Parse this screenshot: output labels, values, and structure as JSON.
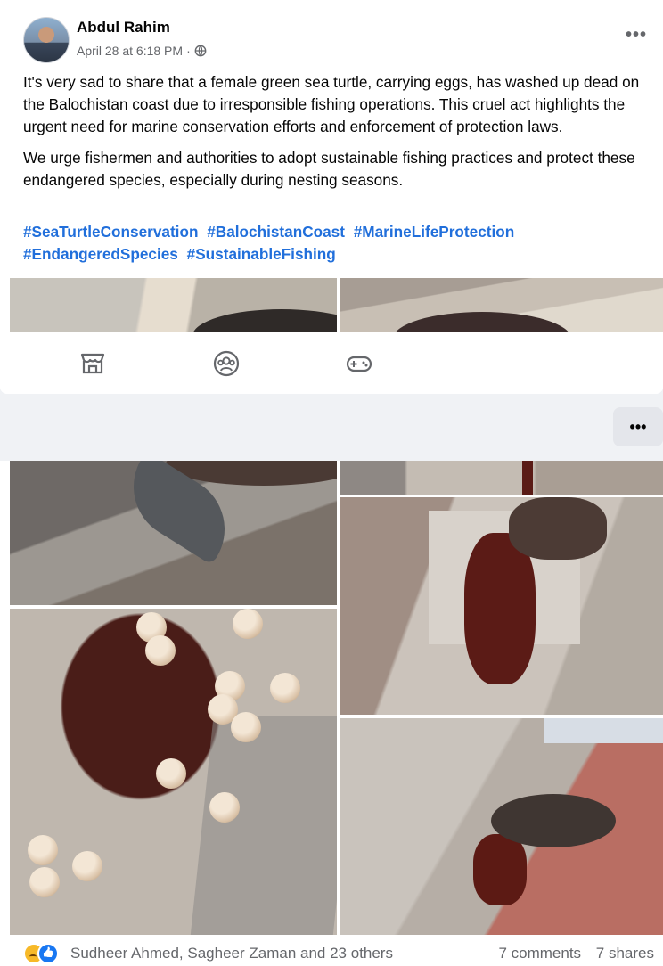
{
  "post": {
    "author": "Abdul Rahim",
    "timestamp": "April 28 at 6:18 PM",
    "separator": "·",
    "more_label": "•••",
    "paragraphs": [
      "It's very sad to share that a female green sea turtle, carrying eggs, has washed up dead on the Balochistan coast due to irresponsible fishing operations. This cruel act highlights the urgent need for marine conservation efforts and enforcement of protection laws.",
      "We urge fishermen and authorities to adopt sustainable fishing practices and protect these endangered species, especially during nesting seasons."
    ],
    "hashtags": [
      "#SeaTurtleConservation",
      "#BalochistanCoast",
      "#MarineLifeProtection",
      "#EndangeredSpecies",
      "#SustainableFishing"
    ]
  },
  "icon_bar": {
    "icons": [
      "marketplace-icon",
      "groups-icon",
      "gaming-icon"
    ]
  },
  "options_button": {
    "label": "•••"
  },
  "footer": {
    "reaction_icons": [
      "sad-reaction-icon",
      "like-reaction-icon"
    ],
    "reactors": "Sudheer Ahmed, Sagheer Zaman and 23 others",
    "comments": "7 comments",
    "shares": "7 shares"
  },
  "colors": {
    "hashtag": "#216fdb",
    "secondary_text": "#65676b",
    "background": "#f0f2f5"
  }
}
